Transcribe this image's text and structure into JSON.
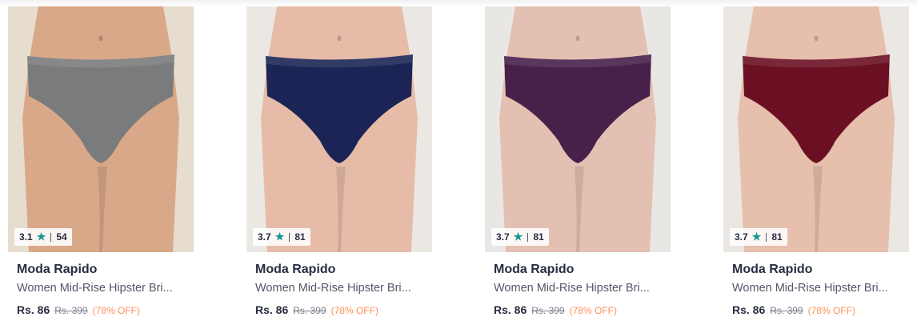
{
  "products": [
    {
      "rating": "3.1",
      "rating_count": "54",
      "brand": "Moda Rapido",
      "title": "Women Mid-Rise Hipster Bri...",
      "price": "Rs. 86",
      "mrp": "Rs. 399",
      "discount": "(78% OFF)",
      "garment_color": "#7a7b7d",
      "background_color": "#e6ddcf",
      "skin_color": "#d9a889"
    },
    {
      "rating": "3.7",
      "rating_count": "81",
      "brand": "Moda Rapido",
      "title": "Women Mid-Rise Hipster Bri...",
      "price": "Rs. 86",
      "mrp": "Rs. 399",
      "discount": "(78% OFF)",
      "garment_color": "#1b2455",
      "background_color": "#ebe8e4",
      "skin_color": "#e6bca8"
    },
    {
      "rating": "3.7",
      "rating_count": "81",
      "brand": "Moda Rapido",
      "title": "Women Mid-Rise Hipster Bri...",
      "price": "Rs. 86",
      "mrp": "Rs. 399",
      "discount": "(78% OFF)",
      "garment_color": "#47214a",
      "background_color": "#e9e7e4",
      "skin_color": "#e4c0b2"
    },
    {
      "rating": "3.7",
      "rating_count": "81",
      "brand": "Moda Rapido",
      "title": "Women Mid-Rise Hipster Bri...",
      "price": "Rs. 86",
      "mrp": "Rs. 399",
      "discount": "(78% OFF)",
      "garment_color": "#6b1023",
      "background_color": "#ebe7e3",
      "skin_color": "#e6bfad"
    }
  ],
  "icons": {
    "rating_star": "star-icon"
  },
  "colors": {
    "star": "#14958f",
    "discount": "#ff905a"
  }
}
